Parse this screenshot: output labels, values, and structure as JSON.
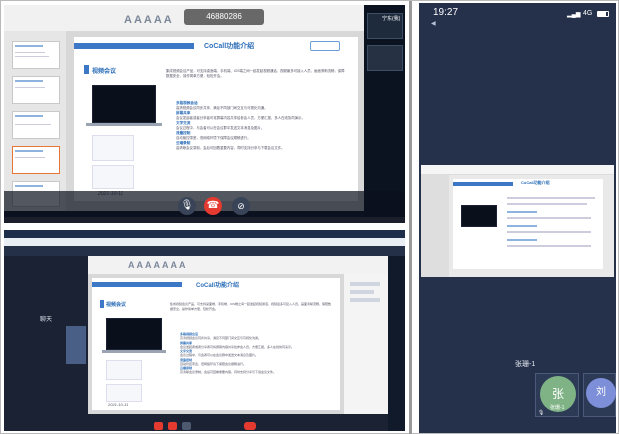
{
  "top_window": {
    "meeting_id": "46880286",
    "name_tag": "宁东(我)",
    "time": "2021-10-11"
  },
  "slide": {
    "title": "CoCall功能介绍",
    "heading": "视频会议",
    "intro": "集成视频会议产品，可支持桌面端、手机端、iOS端之间一起发起视频通话，视频最多可接入人员，画面清晰流畅，保障数据安全，操作简单方便，轻松开会。",
    "sections": [
      {
        "h": "多路视频会话",
        "t": "高清视频会议同步共享，满足不同部门间交互与可视化沟通。"
      },
      {
        "h": "屏幕共享",
        "t": "会议发起者或者分享者可将屏幕内容共享给参会人员，方便汇报、多人在线协同演示。"
      },
      {
        "h": "文字交流",
        "t": "会议过程中，与会者可以在会议群中发送文本消息及图片。"
      },
      {
        "h": "流量控制",
        "t": "自动管控带宽，低网络环境下保障会议顺畅进行。"
      },
      {
        "h": "云端录制",
        "t": "高清晰会议录制，会后可回看重要内容，同时支持分享与下载会议文件。"
      }
    ],
    "date": "2021-10-11"
  },
  "bottom_window": {
    "toolbar_letters": [
      "A",
      "A",
      "A",
      "A",
      "A",
      "A",
      "A",
      "A"
    ],
    "chat_label": "聊天",
    "slide_title": "CoCall功能介绍"
  },
  "phone": {
    "time": "19:27",
    "network": "4G",
    "participant_label": "张珊-1",
    "tiles": [
      {
        "name": "张珊-1",
        "initial": "张",
        "color": "#7fb386"
      },
      {
        "name": "刘",
        "initial": "刘",
        "color": "#7d8fd8"
      }
    ]
  },
  "colors": {
    "accent": "#2d6fb8",
    "danger": "#e43a2f",
    "phone_bg": "#25304a"
  }
}
